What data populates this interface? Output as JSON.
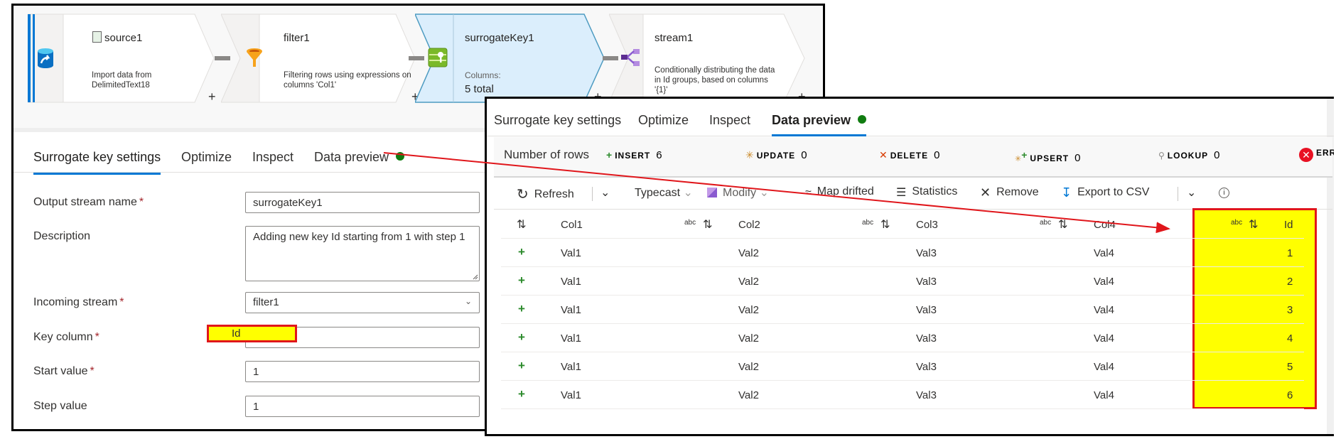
{
  "pipeline": {
    "nodes": [
      {
        "name": "source1",
        "description": "Import data from DelimitedText18",
        "icon": "database-source-icon"
      },
      {
        "name": "filter1",
        "description": "Filtering rows using expressions on columns 'Col1'",
        "icon": "funnel-icon"
      },
      {
        "name": "surrogateKey1",
        "columns_label": "Columns:",
        "columns_value": "5 total",
        "icon": "surrogate-key-icon",
        "selected": true
      },
      {
        "name": "stream1",
        "description": "Conditionally distributing the data in Id groups, based on columns '{1}'",
        "icon": "conditional-split-icon"
      }
    ],
    "add_label": "+"
  },
  "left_panel": {
    "tabs": [
      {
        "label": "Surrogate key settings",
        "active": true
      },
      {
        "label": "Optimize"
      },
      {
        "label": "Inspect"
      },
      {
        "label": "Data preview",
        "status": "ready"
      }
    ],
    "form": {
      "output_stream_name": {
        "label": "Output stream name",
        "required": "*",
        "value": "surrogateKey1"
      },
      "description": {
        "label": "Description",
        "value": "Adding new key Id starting from 1 with step 1"
      },
      "incoming_stream": {
        "label": "Incoming stream",
        "required": "*",
        "value": "filter1"
      },
      "key_column": {
        "label": "Key column",
        "required": "*",
        "value": "Id"
      },
      "start_value": {
        "label": "Start value",
        "required": "*",
        "value": "1"
      },
      "step_value": {
        "label": "Step value",
        "value": "1"
      }
    }
  },
  "right_panel": {
    "tabs": [
      {
        "label": "Surrogate key settings"
      },
      {
        "label": "Optimize"
      },
      {
        "label": "Inspect"
      },
      {
        "label": "Data preview",
        "active": true,
        "status": "ready"
      }
    ],
    "stats": {
      "title": "Number of rows",
      "insert": {
        "label": "INSERT",
        "value": "6"
      },
      "update": {
        "label": "UPDATE",
        "value": "0"
      },
      "delete": {
        "label": "DELETE",
        "value": "0"
      },
      "upsert": {
        "label": "UPSERT",
        "value": "0"
      },
      "lookup": {
        "label": "LOOKUP",
        "value": "0"
      },
      "error": {
        "label": "ERRO"
      }
    },
    "toolbar": {
      "refresh": "Refresh",
      "typecast": "Typecast",
      "modify": "Modify",
      "map_drifted": "Map drifted",
      "statistics": "Statistics",
      "remove": "Remove",
      "export": "Export to CSV"
    },
    "table": {
      "type_label": "abc",
      "columns": [
        "Col1",
        "Col2",
        "Col3",
        "Col4",
        "Id"
      ],
      "rows": [
        [
          "Val1",
          "Val2",
          "Val3",
          "Val4",
          "1"
        ],
        [
          "Val1",
          "Val2",
          "Val3",
          "Val4",
          "2"
        ],
        [
          "Val1",
          "Val2",
          "Val3",
          "Val4",
          "3"
        ],
        [
          "Val1",
          "Val2",
          "Val3",
          "Val4",
          "4"
        ],
        [
          "Val1",
          "Val2",
          "Val3",
          "Val4",
          "5"
        ],
        [
          "Val1",
          "Val2",
          "Val3",
          "Val4",
          "6"
        ]
      ]
    }
  },
  "colors": {
    "accent": "#0078d4",
    "status_ok": "#107c10",
    "highlight_fill": "#ffff00",
    "highlight_border": "#e0161b",
    "selected_node": "#dbeefc"
  }
}
